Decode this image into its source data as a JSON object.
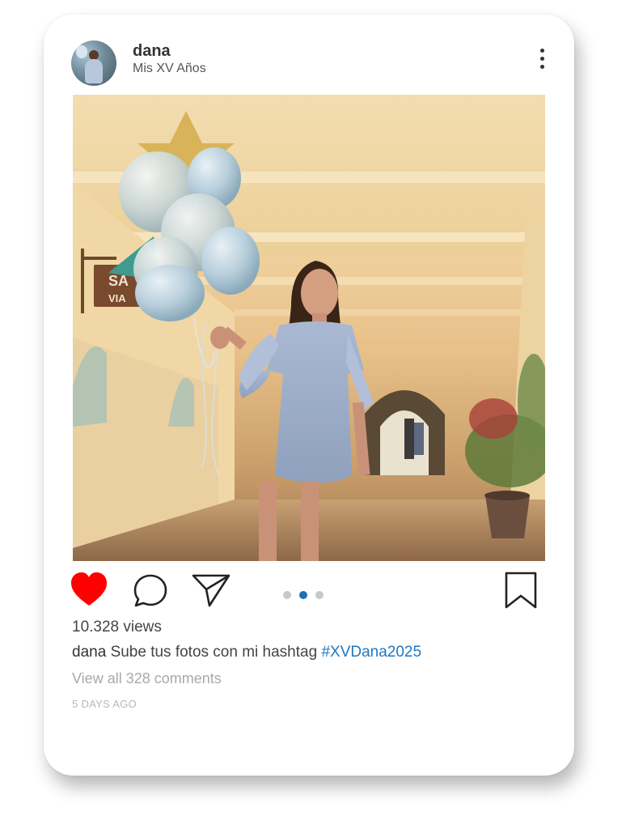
{
  "post": {
    "username": "dana",
    "subtitle": "Mis XV Años",
    "views": "10.328 views",
    "caption_user": "dana",
    "caption_text": "Sube tus fotos con mi hashtag",
    "hashtag": "#XVDana2025",
    "view_comments": "View all 328 comments",
    "timestamp": "5 DAYS AGO"
  },
  "sign": {
    "line1": "SA",
    "line2": "VIA"
  },
  "carousel": {
    "count": 3,
    "active_index": 1
  },
  "icons": {
    "like": "heart-icon",
    "comment": "comment-icon",
    "share": "send-icon",
    "save": "bookmark-icon",
    "more": "more-vertical-icon"
  },
  "colors": {
    "like_red": "#ff0000",
    "hashtag_blue": "#1f78c1",
    "active_dot": "#1f6fb2"
  }
}
